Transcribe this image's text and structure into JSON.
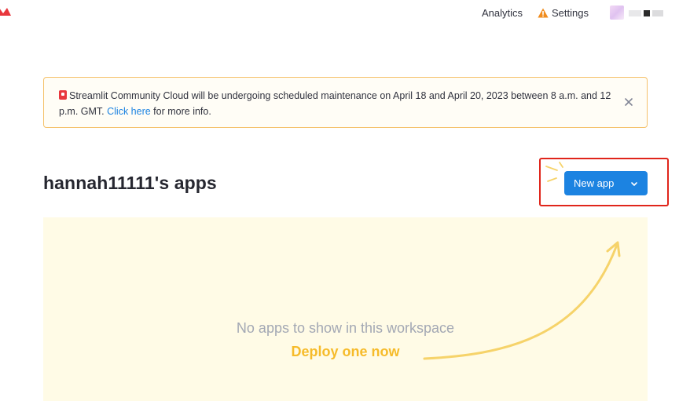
{
  "header": {
    "logo_icon": "streamlit-crown-icon",
    "nav": {
      "analytics_label": "Analytics",
      "settings_label": "Settings",
      "settings_icon": "warning-triangle-icon"
    },
    "colors": {
      "warning": "#f08c1e",
      "logo": "#e8373d"
    }
  },
  "banner": {
    "icon": "pushpin-icon",
    "text_before": "Streamlit Community Cloud will be undergoing scheduled maintenance on April 18 and April 20, 2023 between 8 a.m. and 12 p.m. GMT. ",
    "link_text": "Click here",
    "text_after": " for more info.",
    "close_icon": "close-icon",
    "colors": {
      "border": "#f5c26b",
      "link": "#1c83e1"
    }
  },
  "main": {
    "title": "hannah11111's apps",
    "new_app_button": {
      "label": "New app",
      "caret_icon": "chevron-down-icon",
      "color": "#1c83e1"
    },
    "empty_state": {
      "message": "No apps to show in this workspace",
      "cta": "Deploy one now",
      "colors": {
        "background": "#fffbe6",
        "cta": "#f6bb2a",
        "message": "#a3a8b4"
      }
    }
  }
}
